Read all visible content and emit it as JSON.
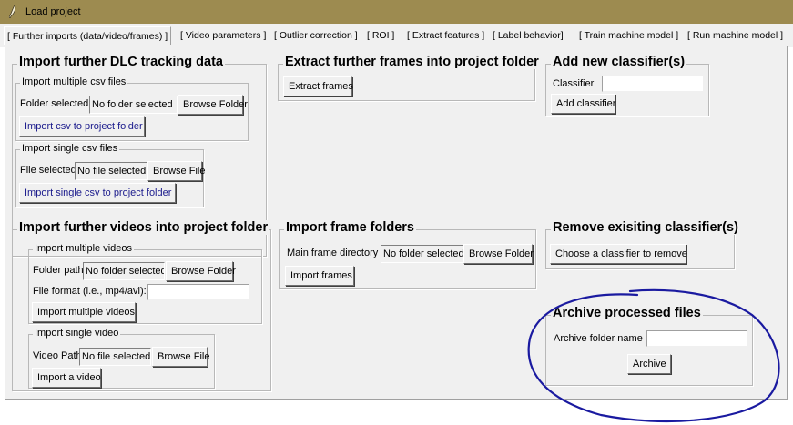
{
  "window": {
    "title": "Load project",
    "app_icon": "feather-icon"
  },
  "tabs": [
    "[ Further imports (data/video/frames) ]",
    "[ Video parameters ]",
    "[ Outlier correction ]",
    "[ ROI ]",
    "[ Extract features ]",
    "[ Label behavior]",
    "[ Train machine model ]",
    "[ Run machine model ]"
  ],
  "dlc": {
    "title": "Import further DLC tracking data",
    "multi": {
      "title": "Import multiple csv files",
      "folder_label": "Folder selected:",
      "folder_value": "No folder selected",
      "browse": "Browse Folder",
      "import_btn": "Import csv to project folder"
    },
    "single": {
      "title": "Import single csv files",
      "file_label": "File selected",
      "file_value": "No file selected",
      "browse": "Browse File",
      "import_btn": "Import single csv to project folder"
    }
  },
  "extract": {
    "title": "Extract further frames into project folder",
    "button": "Extract frames"
  },
  "classifier_add": {
    "title": "Add new classifier(s)",
    "label": "Classifier",
    "input_value": "",
    "button": "Add classifier"
  },
  "videos": {
    "title": "Import further videos into project folder",
    "multi": {
      "title": "Import multiple videos",
      "folder_label": "Folder path",
      "folder_value": "No folder selected",
      "browse": "Browse Folder",
      "format_label": "File format (i.e., mp4/avi):",
      "format_value": "",
      "import_btn": "Import multiple videos"
    },
    "single": {
      "title": "Import single video",
      "path_label": "Video Path",
      "path_value": "No file selected",
      "browse": "Browse File",
      "import_btn": "Import a video"
    }
  },
  "frames": {
    "title": "Import frame folders",
    "dir_label": "Main frame directory",
    "dir_value": "No folder selected",
    "browse": "Browse Folder",
    "import_btn": "Import frames"
  },
  "classifier_remove": {
    "title": "Remove exisiting classifier(s)",
    "button": "Choose a classifier to remove"
  },
  "archive": {
    "title": "Archive processed files",
    "label": "Archive folder name",
    "input_value": "",
    "button": "Archive"
  },
  "colors": {
    "titlebar": "#9d8b50",
    "annotation": "#1a1aa0",
    "background": "#f0f0f0"
  }
}
